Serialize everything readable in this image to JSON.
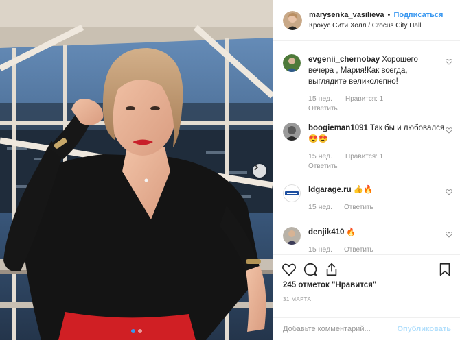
{
  "header": {
    "username": "marysenka_vasilieva",
    "separator": "•",
    "follow_label": "Подписаться",
    "location": "Крокус Сити Холл / Crocus City Hall"
  },
  "comments": [
    {
      "username": "evgenii_chernobay",
      "text": "Хорошего вечера , Мария!Как всегда, выглядите великолепно!",
      "ago": "15 нед.",
      "likes": "Нравится: 1",
      "reply": "Ответить"
    },
    {
      "username": "boogieman1091",
      "text": "Так бы и любовался😍😍",
      "ago": "15 нед.",
      "likes": "Нравится: 1",
      "reply": "Ответить"
    },
    {
      "username": "ldgarage.ru",
      "text": "👍🔥",
      "ago": "15 нед.",
      "reply": "Ответить"
    },
    {
      "username": "denjik410",
      "text": "🔥",
      "ago": "15 нед.",
      "reply": "Ответить"
    }
  ],
  "actions": {
    "like_icon": "heart-outline-icon",
    "comment_icon": "speech-bubble-icon",
    "share_icon": "share-arrow-icon",
    "save_icon": "bookmark-icon",
    "likes_count": "245 отметок \"Нравится\"",
    "date": "31 МАРТА"
  },
  "add_comment": {
    "placeholder": "Добавьте комментарий...",
    "publish_label": "Опубликовать"
  },
  "carousel": {
    "total": 2,
    "active": 1
  },
  "colors": {
    "accent": "#3897f0",
    "text": "#262626",
    "muted": "#999999",
    "publish_disabled": "#b2dffc",
    "border": "#efefef"
  }
}
